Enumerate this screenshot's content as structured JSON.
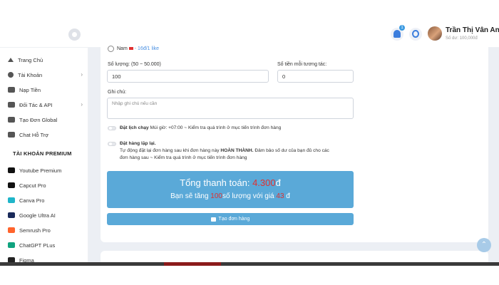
{
  "header": {
    "user_name": "Trần Thị Vân Anh",
    "user_balance": "Số dư: 100,000đ",
    "notification_count": "1"
  },
  "sidebar": {
    "items": [
      {
        "label": "Trang Chủ",
        "icon": "home-icon"
      },
      {
        "label": "Tài Khoản",
        "icon": "user-icon",
        "has_submenu": true
      },
      {
        "label": "Nạp Tiền",
        "icon": "card-icon"
      },
      {
        "label": "Đối Tác & API",
        "icon": "bag-icon",
        "has_submenu": true
      },
      {
        "label": "Tạo Đơn Global",
        "icon": "globe-icon"
      },
      {
        "label": "Chat Hỗ Trợ",
        "icon": "chat-icon"
      }
    ],
    "premium_heading": "TÀI KHOẢN PREMIUM",
    "premium_items": [
      {
        "label": "Youtube Premium",
        "icon": "youtube-icon",
        "color": "#111111"
      },
      {
        "label": "Capcut Pro",
        "icon": "capcut-icon",
        "color": "#111111"
      },
      {
        "label": "Canva Pro",
        "icon": "canva-icon",
        "color": "#1fb5c9"
      },
      {
        "label": "Google Ultra AI",
        "icon": "google-ai-icon",
        "color": "#1a2a5a"
      },
      {
        "label": "Semrush Pro",
        "icon": "semrush-icon",
        "color": "#ff642d"
      },
      {
        "label": "ChatGPT PLus",
        "icon": "chatgpt-icon",
        "color": "#10a37f"
      },
      {
        "label": "Figma",
        "icon": "figma-icon",
        "color": "#222222"
      }
    ]
  },
  "form": {
    "gender_option": "Nam",
    "gender_price": "- 16đ/1 like",
    "quantity_label": "Số lượng: (50 ~ 50.000)",
    "quantity_value": "100",
    "per_interaction_label": "Số tiền mỗi tương tác:",
    "per_interaction_value": "0",
    "note_label": "Ghi chú:",
    "note_placeholder": "Nhập ghi chú nếu cần",
    "schedule_label": "Đặt lịch chạy",
    "schedule_desc": "Múi giờ: +07:00 ~ Kiểm tra quá trình ở mục tiến trình đơn hàng",
    "repeat_title": "Đặt hàng lặp lại.",
    "repeat_desc_1": "Tự động đặt lại đơn hàng sau khi đơn hàng này ",
    "repeat_desc_bold": "HOÀN THÀNH.",
    "repeat_desc_2": " Đảm bảo số dư của bạn đủ cho các",
    "repeat_desc_3": "đơn hàng sau ~ Kiểm tra quá trình ở mục tiến trình đơn hàng"
  },
  "summary": {
    "total_label": "Tổng thanh toán: ",
    "total_value": "4.300",
    "total_currency": "đ",
    "line2_a": "Bạn sẽ tăng ",
    "line2_qty": "100",
    "line2_b": "số lượng với giá ",
    "line2_price": "43",
    "line2_c": " đ"
  },
  "actions": {
    "create_order_label": "Tạo đơn hàng",
    "scroll_top_glyph": "⌃"
  },
  "colors": {
    "accent": "#5aa9d8",
    "highlight": "#e03131"
  }
}
